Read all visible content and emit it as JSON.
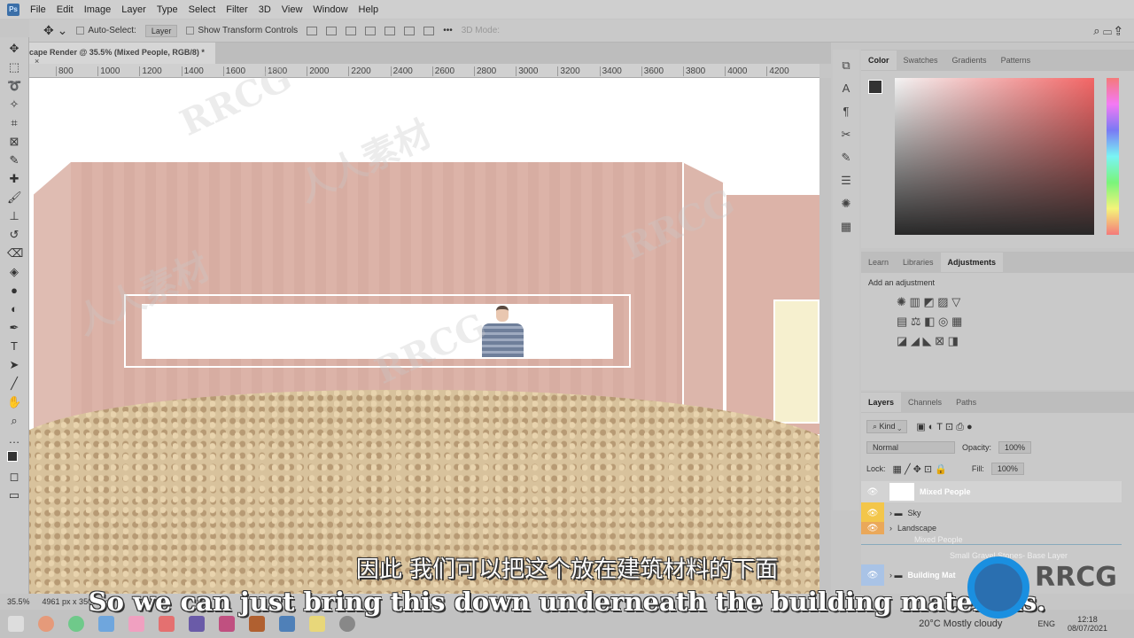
{
  "menu": {
    "app_icon": "Ps",
    "items": [
      "File",
      "Edit",
      "Image",
      "Layer",
      "Type",
      "Select",
      "Filter",
      "3D",
      "View",
      "Window",
      "Help"
    ]
  },
  "options": {
    "auto_select_label": "Auto-Select:",
    "auto_select_value": "Layer",
    "show_transform": "Show Transform Controls",
    "mode_3d": "3D Mode:"
  },
  "document": {
    "tab_title": "cape Render @ 35.5% (Mixed People, RGB/8) *",
    "close": "×"
  },
  "ruler": [
    "800",
    "1000",
    "1200",
    "1400",
    "1600",
    "1800",
    "2000",
    "2200",
    "2400",
    "2600",
    "2800",
    "3000",
    "3200",
    "3400",
    "3600",
    "3800",
    "4000",
    "4200"
  ],
  "status": {
    "zoom": "35.5%",
    "dimensions": "4961 px x 3508 px"
  },
  "color_panel": {
    "tabs": [
      "Color",
      "Swatches",
      "Gradients",
      "Patterns"
    ],
    "active": "Color"
  },
  "adjust_panel": {
    "tabs": [
      "Learn",
      "Libraries",
      "Adjustments"
    ],
    "active": "Adjustments",
    "hint": "Add an adjustment"
  },
  "layers_panel": {
    "tabs": [
      "Layers",
      "Channels",
      "Paths"
    ],
    "active": "Layers",
    "kind": "Kind",
    "blend": "Normal",
    "opacity_label": "Opacity:",
    "opacity": "100%",
    "lock_label": "Lock:",
    "fill_label": "Fill:",
    "fill": "100%",
    "layers": [
      {
        "name": "Mixed People",
        "color": "#cfcfcf"
      },
      {
        "name": "Sky",
        "color": "#f3c64a"
      },
      {
        "name": "Landscape",
        "color": "#eaa85a"
      },
      {
        "name": "Mixed People",
        "color": "#c9c9c9"
      },
      {
        "name": "Small Gravel Stones- Base Layer",
        "color": "#c9c9c9"
      },
      {
        "name": "Building Mat",
        "color": "#a9c3e6"
      }
    ]
  },
  "subtitles": {
    "zh": "因此 我们可以把这个放在建筑材料的下面",
    "en": "So we can just bring this down underneath the building materials."
  },
  "watermark": {
    "brand": "RRCG",
    "zh": "人人素材"
  },
  "taskbar": {
    "weather": "20°C  Mostly cloudy",
    "lang": "ENG",
    "time": "12:18",
    "date": "08/07/2021",
    "apps": [
      "windows",
      "chrome",
      "spotify",
      "outlook",
      "photos",
      "acrobat",
      "premiere",
      "indesign",
      "illustrator",
      "photoshop",
      "explorer",
      "obs"
    ]
  }
}
